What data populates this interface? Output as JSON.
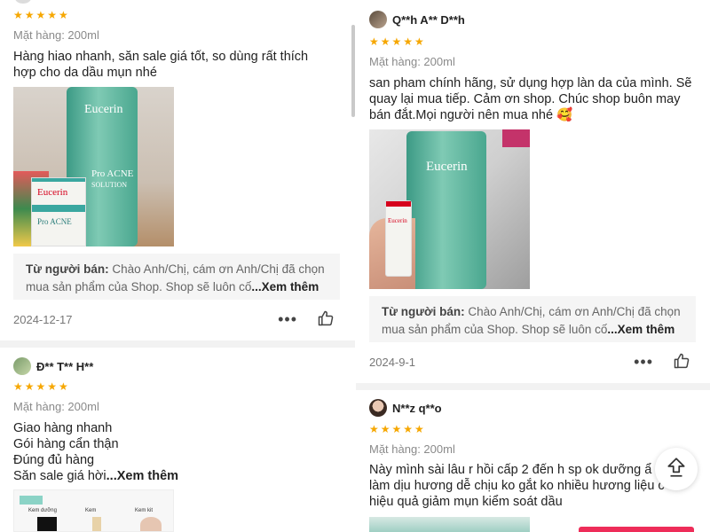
{
  "left": {
    "review1": {
      "stars": "★★★★★",
      "variant": "Mặt hàng: 200ml",
      "text": "Hàng hiao nhanh, săn sale giá tốt, so dùng rất thích hợp cho da dầu mụn nhé",
      "product_brand": "Eucerin",
      "product_line1": "Pro ACNE",
      "product_line2": "SOLUTION",
      "seller_label": "Từ người bán:",
      "seller_text": "Chào Anh/Chị, cám ơn Anh/Chị đã chọn mua sản phẩm của Shop. Shop sẽ luôn cố",
      "see_more": "...Xem thêm",
      "date": "2024-12-17",
      "dots": "•••"
    },
    "review2": {
      "user": "Đ** T** H**",
      "stars": "★★★★★",
      "variant": "Mặt hàng: 200ml",
      "lines": [
        "Giao hàng nhanh",
        "Gói hàng cẩn thận",
        "Đúng đủ hàng",
        "Săn sale giá hời"
      ],
      "see_more": "...Xem thêm",
      "img_labels": [
        "Kem dưỡng",
        "Kem",
        "Kem kit"
      ]
    }
  },
  "right": {
    "review1": {
      "user": "Q**h A** D**h",
      "stars": "★★★★★",
      "variant": "Mặt hàng: 200ml",
      "text": "san pham chính hãng, sử dụng hợp làn da của mình. Sẽ quay lại mua tiếp. Cảm ơn shop. Chúc shop buôn may bán đắt.Mọi người nên mua nhé 🥰",
      "product_brand": "Eucerin",
      "seller_label": "Từ người bán:",
      "seller_text": "Chào Anh/Chị, cám ơn Anh/Chị đã chọn mua sản phẩm của Shop. Shop sẽ luôn cố",
      "see_more": "...Xem thêm",
      "date": "2024-9-1",
      "dots": "•••"
    },
    "review2": {
      "user": "N**z q**o",
      "stars": "★★★★★",
      "variant": "Mặt hàng: 200ml",
      "lines": [
        "Này mình sài lâu r hồi cấp 2 đến h sp ok dưỡng ẩ",
        "làm dịu hương dễ chịu ko gắt ko nhiều hương liệu c",
        "hiệu quả giảm mụn kiểm soát dầu"
      ]
    }
  },
  "icons": {
    "like": "thumbs-up-icon",
    "more": "more-dots-icon",
    "scroll_top": "scroll-to-top-icon"
  },
  "colors": {
    "star": "#f6a700",
    "seller_bg": "#f5f5f5",
    "product_green": "#3c9a85",
    "accent_pink": "#ee2d59"
  }
}
